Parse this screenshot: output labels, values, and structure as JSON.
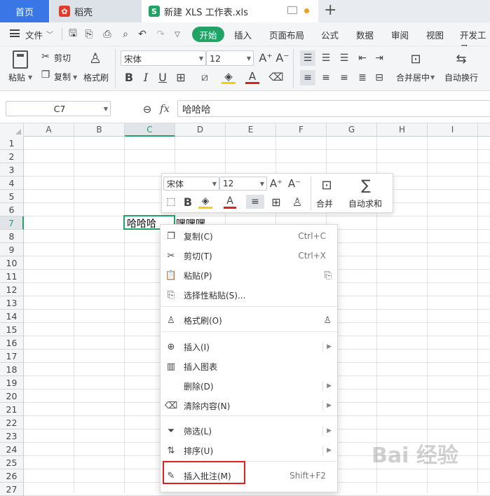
{
  "tabs": {
    "home": "首页",
    "daoke": "稻壳",
    "doc": "新建 XLS 工作表.xls",
    "add": "+"
  },
  "menu": {
    "file": "文件",
    "items": [
      "开始",
      "插入",
      "页面布局",
      "公式",
      "数据",
      "审阅",
      "视图",
      "开发工具"
    ]
  },
  "toolbar": {
    "paste": "粘贴",
    "cut": "剪切",
    "copy": "复制",
    "format_painter": "格式刷",
    "font": "宋体",
    "font_size": "12",
    "merge": "合并居中",
    "wrap": "自动换行"
  },
  "formula_bar": {
    "cell_ref": "C7",
    "fx": "fx",
    "content": "哈哈哈"
  },
  "grid": {
    "columns": [
      "A",
      "B",
      "C",
      "D",
      "E",
      "F",
      "G",
      "H",
      "I"
    ],
    "rows": [
      "1",
      "2",
      "3",
      "4",
      "5",
      "6",
      "7",
      "8",
      "9",
      "10",
      "11",
      "12",
      "13",
      "14",
      "15",
      "16",
      "17",
      "18",
      "19",
      "20",
      "21",
      "22",
      "23",
      "24",
      "25",
      "26",
      "27"
    ],
    "selected_col": "C",
    "selected_row": "7",
    "c7": "哈哈哈",
    "d7": "嘿嘿嘿"
  },
  "mini_toolbar": {
    "font": "宋体",
    "size": "12",
    "merge": "合并",
    "autosum": "自动求和"
  },
  "context_menu": {
    "items": [
      {
        "label": "复制(C)",
        "shortcut": "Ctrl+C",
        "icon": "copy-icon"
      },
      {
        "label": "剪切(T)",
        "shortcut": "Ctrl+X",
        "icon": "scissors-icon"
      },
      {
        "label": "粘贴(P)",
        "shortcut": "",
        "icon": "paste-icon"
      },
      {
        "label": "选择性粘贴(S)...",
        "shortcut": "",
        "icon": "paste-special-icon"
      },
      {
        "label": "格式刷(O)",
        "shortcut": "",
        "icon": "format-painter-icon"
      },
      {
        "label": "插入(I)",
        "shortcut": "",
        "icon": "insert-icon"
      },
      {
        "label": "插入图表",
        "shortcut": "",
        "icon": "chart-icon"
      },
      {
        "label": "删除(D)",
        "shortcut": "",
        "icon": ""
      },
      {
        "label": "清除内容(N)",
        "shortcut": "",
        "icon": "clear-icon"
      },
      {
        "label": "筛选(L)",
        "shortcut": "",
        "icon": "filter-icon"
      },
      {
        "label": "排序(U)",
        "shortcut": "",
        "icon": "sort-icon"
      },
      {
        "label": "插入批注(M)",
        "shortcut": "Shift+F2",
        "icon": "comment-icon"
      }
    ]
  },
  "watermark": "Bai 经验",
  "colors": {
    "accent_green": "#21a366",
    "home_tab_blue": "#3a76e6",
    "highlight_red": "#e02020"
  }
}
